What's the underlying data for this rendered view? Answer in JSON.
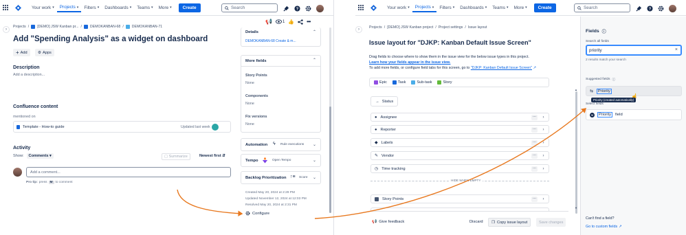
{
  "nav": {
    "your_work": "Your work",
    "projects": "Projects",
    "filters": "Filters",
    "dashboards": "Dashboards",
    "teams": "Teams",
    "more": "More",
    "create": "Create",
    "search_placeholder": "Search"
  },
  "left": {
    "breadcrumbs": [
      "Projects",
      "/",
      "[DEMO] JSW Kanban pr...",
      "/",
      "DEMOKANBAN-68",
      "/",
      "DEMOKANBAN-71"
    ],
    "watch_count": "1",
    "title": "Add \"Spending Analysis\" as a widget on dashboard",
    "add_label": "Add",
    "apps_label": "Apps",
    "description_heading": "Description",
    "description_placeholder": "Add a description...",
    "confluence_heading": "Confluence content",
    "mentioned_on": "mentioned on",
    "confluence_page": "Template - How-to guide",
    "updated_last_week": "Updated last week",
    "activity_heading": "Activity",
    "show_label": "Show:",
    "comments_filter": "Comments",
    "summarize": "Summarize",
    "newest_first": "Newest first",
    "comment_placeholder": "Add a comment...",
    "pro_tip_1": "Pro tip:",
    "pro_tip_2": "press",
    "pro_tip_key": "M",
    "pro_tip_3": "to comment",
    "details_heading": "Details",
    "details_link": "DEMOKANBAN-68 Create & m...",
    "more_fields_heading": "More fields",
    "story_points_label": "Story Points",
    "story_points_value": "None",
    "components_label": "Components",
    "components_value": "None",
    "fix_versions_label": "Fix versions",
    "fix_versions_value": "None",
    "automation_label": "Automation",
    "rule_executions": "Rule executions",
    "tempo_label": "Tempo",
    "open_tempo": "Open Tempo",
    "backlog_label": "Backlog Prioritization",
    "score_label": "Score",
    "created": "Created May 20, 2024 at 2:29 PM",
    "updated": "Updated November 12, 2024 at 12:03 PM",
    "resolved": "Resolved May 20, 2024 at 2:31 PM",
    "configure": "Configure"
  },
  "right": {
    "breadcrumbs": [
      "Projects",
      "/",
      "[DEMO] JSW Kanban project",
      "/",
      "Project settings",
      "/",
      "Issue layout"
    ],
    "title": "Issue layout for \"DJKP: Kanban Default Issue Screen\"",
    "desc_1": "Drag fields to choose where to show them in the issue view for the below issue types in this project.",
    "desc_link": "Learn how your fields appear in the issue view.",
    "desc_2": "To add more fields, or configure field tabs for this screen, go to",
    "desc_2_link": "\"DJKP: Kanban Default Issue Screen\"",
    "issue_types": [
      "Epic",
      "Task",
      "Sub-task",
      "Story"
    ],
    "status_label": "Status",
    "fields": [
      "Assignee",
      "Reporter",
      "Labels",
      "Vendor",
      "Time tracking"
    ],
    "hide_when_empty": "HIDE WHEN EMPTY",
    "story_points": "Story Points",
    "give_feedback": "Give feedback",
    "discard": "Discard",
    "copy_issue_layout": "Copy issue layout",
    "save_changes": "Save changes",
    "fields_panel_title": "Fields",
    "search_all_fields": "Search all fields",
    "search_value": "priority",
    "results_text": "2 results match your search",
    "suggested_fields": "Suggested fields",
    "suggested_priority": "Priority",
    "tooltip": "Priority (created automatically)",
    "select_fields": "Select fields",
    "priority_field_1": "Priority",
    "priority_field_2": "field",
    "cant_find": "Can't find a field?",
    "go_custom": "Go to custom fields"
  },
  "colors": {
    "accent": "#0c66e4",
    "arrow": "#e8781e"
  }
}
